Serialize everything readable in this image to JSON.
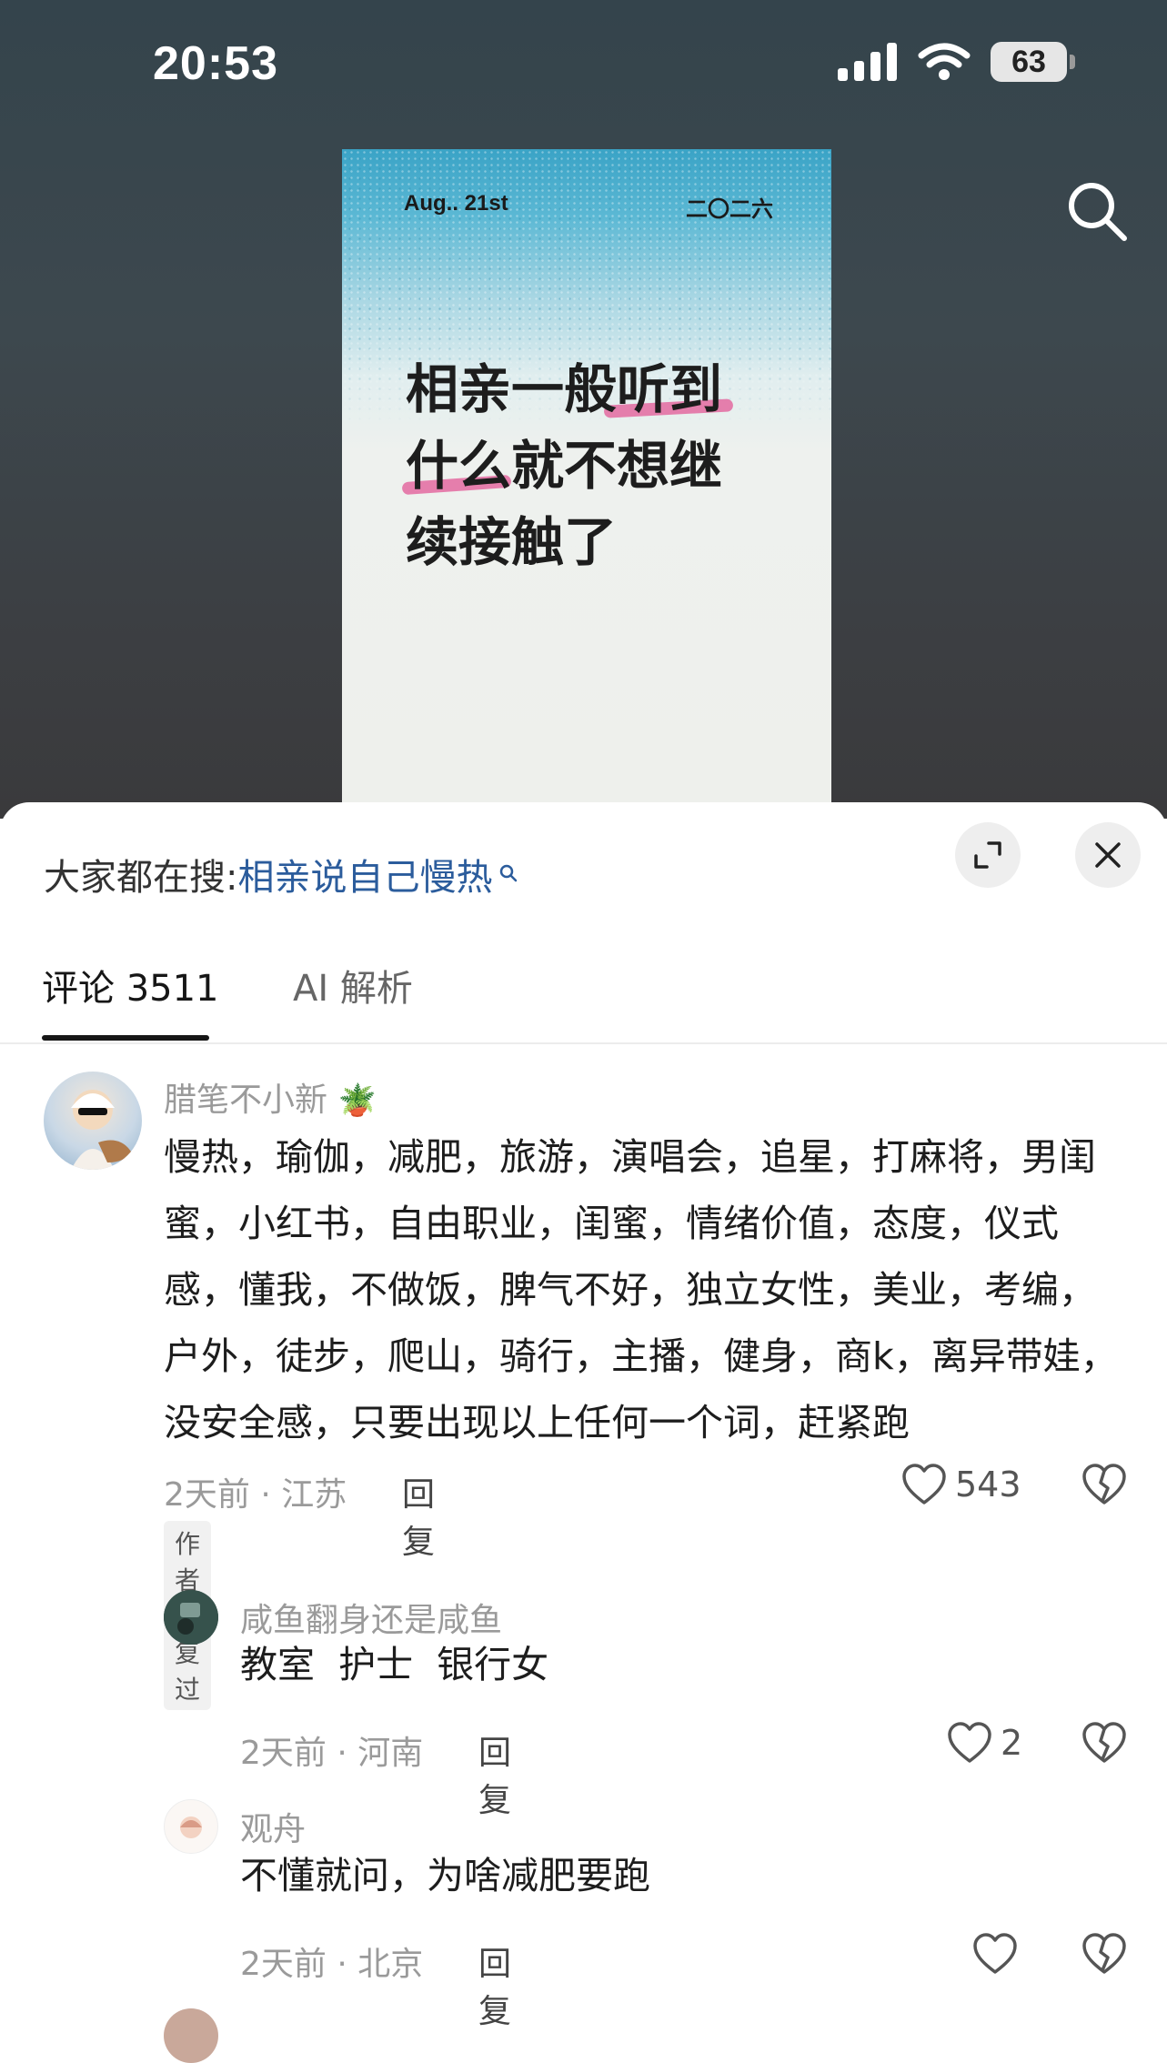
{
  "status_bar": {
    "time": "20:53",
    "battery": "63"
  },
  "poster": {
    "date": "Aug.. 21st",
    "year": "二〇二六",
    "title": "相亲一般听到什么就不想继续接触了"
  },
  "sheet": {
    "trending_prefix": "大家都在搜:",
    "trending_term": "相亲说自己慢热",
    "tabs": [
      {
        "label": "评论 3511",
        "active": true
      },
      {
        "label": "AI 解析",
        "active": false
      }
    ]
  },
  "comments": [
    {
      "username": "腊笔不小新",
      "text": "慢热，瑜伽，减肥，旅游，演唱会，追星，打麻将，男闺蜜，小红书，自由职业，闺蜜，情绪价值，态度，仪式感，懂我，不做饭，脾气不好，独立女性，美业，考编，户外，徒步，爬山，骑行，主播，健身，商k，离异带娃，没安全感，只要出现以上任何一个词，赶紧跑",
      "meta": "2天前 · 江苏",
      "reply_label": "回复",
      "likes": "543",
      "badge": "作者回复过"
    },
    {
      "username": "咸鱼翻身还是咸鱼",
      "text": "教室  护士  银行女",
      "meta": "2天前 · 河南",
      "reply_label": "回复",
      "likes": "2"
    },
    {
      "username": "观舟",
      "text": "不懂就问，为啥减肥要跑",
      "meta": "2天前 · 北京",
      "reply_label": "回复",
      "likes": ""
    }
  ],
  "colors": {
    "accent_link": "#2b5c9c",
    "highlight_pink": "#e36aa0"
  }
}
